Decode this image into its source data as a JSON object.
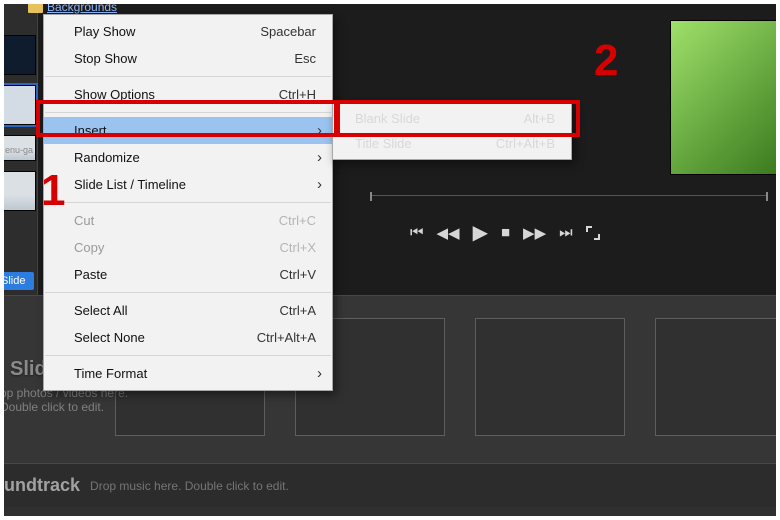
{
  "header": {
    "folder_label": "Backgrounds"
  },
  "left": {
    "enu_ga_label": "enu-ga",
    "slide_btn": "Slide"
  },
  "transport": {
    "prev": "⏮",
    "rew": "◀◀",
    "play": "▶",
    "stop": "■",
    "ff": "▶▶",
    "next": "⏭"
  },
  "slides_panel": {
    "title": "Slides",
    "hint_line1": "op photos / videos here.",
    "hint_line2": "Double click to edit."
  },
  "soundtrack": {
    "title": "undtrack",
    "hint": "Drop music here.  Double click to edit."
  },
  "menu": [
    {
      "label": "Play Show",
      "shortcut": "Spacebar"
    },
    {
      "label": "Stop Show",
      "shortcut": "Esc"
    },
    {
      "sep": true
    },
    {
      "label": "Show Options",
      "shortcut": "Ctrl+H"
    },
    {
      "sep": true
    },
    {
      "label": "Insert",
      "sub": true,
      "highlight": true
    },
    {
      "label": "Randomize",
      "sub": true
    },
    {
      "label": "Slide List / Timeline",
      "sub": true
    },
    {
      "sep": true
    },
    {
      "label": "Cut",
      "shortcut": "Ctrl+C",
      "disabled": true
    },
    {
      "label": "Copy",
      "shortcut": "Ctrl+X",
      "disabled": true
    },
    {
      "label": "Paste",
      "shortcut": "Ctrl+V"
    },
    {
      "sep": true
    },
    {
      "label": "Select All",
      "shortcut": "Ctrl+A"
    },
    {
      "label": "Select None",
      "shortcut": "Ctrl+Alt+A"
    },
    {
      "sep": true
    },
    {
      "label": "Time Format",
      "sub": true
    }
  ],
  "submenu": [
    {
      "label": "Blank Slide",
      "shortcut": "Alt+B"
    },
    {
      "label": "Title Slide",
      "shortcut": "Ctrl+Alt+B"
    }
  ],
  "annotations": {
    "one": "1",
    "two": "2"
  }
}
